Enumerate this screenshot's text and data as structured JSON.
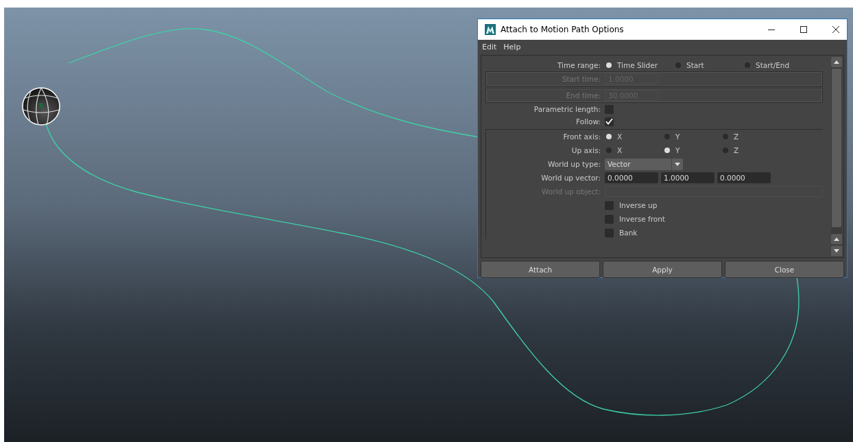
{
  "window": {
    "title": "Attach to Motion Path Options"
  },
  "menu": [
    {
      "label": "Edit"
    },
    {
      "label": "Help"
    }
  ],
  "time_range": {
    "label": "Time range:",
    "options": [
      {
        "label": "Time Slider",
        "selected": true
      },
      {
        "label": "Start",
        "selected": false
      },
      {
        "label": "Start/End",
        "selected": false
      }
    ]
  },
  "start_time": {
    "label": "Start time:",
    "value": "1.0000",
    "disabled": true
  },
  "end_time": {
    "label": "End time:",
    "value": "30.0000",
    "disabled": true
  },
  "parametric_length": {
    "label": "Parametric length:",
    "checked": false
  },
  "follow": {
    "label": "Follow:",
    "checked": true
  },
  "front_axis": {
    "label": "Front axis:",
    "options": [
      {
        "label": "X",
        "selected": true
      },
      {
        "label": "Y",
        "selected": false
      },
      {
        "label": "Z",
        "selected": false
      }
    ]
  },
  "up_axis": {
    "label": "Up axis:",
    "options": [
      {
        "label": "X",
        "selected": false
      },
      {
        "label": "Y",
        "selected": true
      },
      {
        "label": "Z",
        "selected": false
      }
    ]
  },
  "world_up_type": {
    "label": "World up type:",
    "value": "Vector"
  },
  "world_up_vector": {
    "label": "World up vector:",
    "values": [
      "0.0000",
      "1.0000",
      "0.0000"
    ]
  },
  "world_up_object": {
    "label": "World up object:",
    "disabled": true
  },
  "options": [
    {
      "label": "Inverse up",
      "checked": false
    },
    {
      "label": "Inverse front",
      "checked": false
    },
    {
      "label": "Bank",
      "checked": false
    }
  ],
  "buttons": [
    {
      "label": "Attach"
    },
    {
      "label": "Apply"
    },
    {
      "label": "Close"
    }
  ]
}
